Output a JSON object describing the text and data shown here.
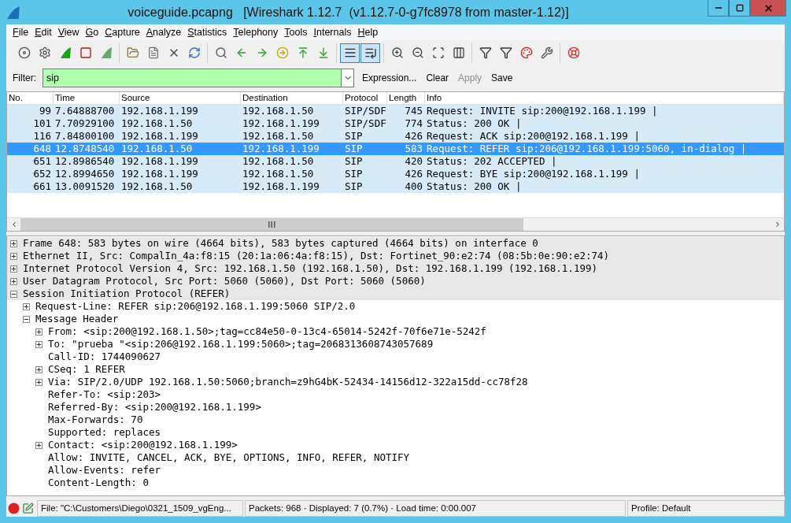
{
  "window": {
    "title": "voiceguide.pcapng   [Wireshark 1.12.7  (v1.12.7-0-g7fc8978 from master-1.12)]"
  },
  "menu": [
    "File",
    "Edit",
    "View",
    "Go",
    "Capture",
    "Analyze",
    "Statistics",
    "Telephony",
    "Tools",
    "Internals",
    "Help"
  ],
  "toolbar": {
    "groups": [
      [
        {
          "pressed": false
        },
        {
          "pressed": false
        },
        {
          "pressed": false
        },
        {
          "pressed": false
        },
        {
          "pressed": false
        }
      ],
      [
        {
          "pressed": false
        },
        {
          "pressed": false
        },
        {
          "pressed": false
        },
        {
          "pressed": false
        }
      ],
      [
        {
          "pressed": false
        },
        {
          "pressed": false
        },
        {
          "pressed": false
        },
        {
          "pressed": false
        },
        {
          "pressed": false
        },
        {
          "pressed": false
        }
      ],
      [
        {
          "pressed": true
        },
        {
          "pressed": true
        }
      ],
      [
        {
          "pressed": false
        },
        {
          "pressed": false
        },
        {
          "pressed": false
        },
        {
          "pressed": false
        }
      ],
      [
        {
          "pressed": false
        },
        {
          "pressed": false
        },
        {
          "pressed": false
        },
        {
          "pressed": false
        }
      ],
      [
        {
          "pressed": false
        }
      ]
    ]
  },
  "filter": {
    "label": "Filter:",
    "value": "sip",
    "buttons": [
      {
        "label": "Expression...",
        "disabled": false
      },
      {
        "label": "Clear",
        "disabled": false
      },
      {
        "label": "Apply",
        "disabled": true
      },
      {
        "label": "Save",
        "disabled": false
      }
    ]
  },
  "packet_list": {
    "columns": [
      "No.",
      "Time",
      "Source",
      "Destination",
      "Protocol",
      "Length",
      "Info"
    ],
    "rows": [
      {
        "cells": [
          "99",
          "7.64888700",
          "192.168.1.199",
          "192.168.1.50",
          "SIP/SDF",
          "745",
          "Request: INVITE sip:200@192.168.1.199 |"
        ],
        "selected": false
      },
      {
        "cells": [
          "101",
          "7.70929100",
          "192.168.1.50",
          "192.168.1.199",
          "SIP/SDF",
          "774",
          "Status: 200 OK |"
        ],
        "selected": false
      },
      {
        "cells": [
          "116",
          "7.84800100",
          "192.168.1.199",
          "192.168.1.50",
          "SIP",
          "426",
          "Request: ACK sip:200@192.168.1.199 |"
        ],
        "selected": false
      },
      {
        "cells": [
          "648",
          "12.8748540",
          "192.168.1.50",
          "192.168.1.199",
          "SIP",
          "583",
          "Request: REFER sip:206@192.168.1.199:5060, in-dialog |"
        ],
        "selected": true
      },
      {
        "cells": [
          "651",
          "12.8986540",
          "192.168.1.199",
          "192.168.1.50",
          "SIP",
          "420",
          "Status: 202 ACCEPTED |"
        ],
        "selected": false
      },
      {
        "cells": [
          "652",
          "12.8994650",
          "192.168.1.199",
          "192.168.1.50",
          "SIP",
          "426",
          "Request: BYE sip:200@192.168.1.199 |"
        ],
        "selected": false
      },
      {
        "cells": [
          "661",
          "13.0091520",
          "192.168.1.50",
          "192.168.1.199",
          "SIP",
          "400",
          "Status: 200 OK |"
        ],
        "selected": false
      }
    ]
  },
  "details": [
    {
      "kind": "branch",
      "expanded": false,
      "text": "Frame 648: 583 bytes on wire (4664 bits), 583 bytes captured (4664 bits) on interface 0"
    },
    {
      "kind": "branch",
      "expanded": false,
      "text": "Ethernet II, Src: CompalIn_4a:f8:15 (20:1a:06:4a:f8:15), Dst: Fortinet_90:e2:74 (08:5b:0e:90:e2:74)"
    },
    {
      "kind": "branch",
      "expanded": false,
      "text": "Internet Protocol Version 4, Src: 192.168.1.50 (192.168.1.50), Dst: 192.168.1.199 (192.168.1.199)"
    },
    {
      "kind": "branch",
      "expanded": false,
      "text": "User Datagram Protocol, Src Port: 5060 (5060), Dst Port: 5060 (5060)"
    },
    {
      "kind": "branch",
      "expanded": true,
      "text": "Session Initiation Protocol (REFER)",
      "children": [
        {
          "kind": "branch",
          "expanded": false,
          "text": "Request-Line: REFER sip:206@192.168.1.199:5060 SIP/2.0"
        },
        {
          "kind": "branch",
          "expanded": true,
          "text": "Message Header",
          "children": [
            {
              "kind": "branch",
              "expanded": false,
              "text": "From: <sip:200@192.168.1.50>;tag=cc84e50-0-13c4-65014-5242f-70f6e71e-5242f"
            },
            {
              "kind": "branch",
              "expanded": false,
              "text": "To: \"prueba \"<sip:206@192.168.1.199:5060>;tag=2068313608743057689"
            },
            {
              "kind": "leaf",
              "text": "Call-ID: 1744090627"
            },
            {
              "kind": "branch",
              "expanded": false,
              "text": "CSeq: 1 REFER"
            },
            {
              "kind": "branch",
              "expanded": false,
              "text": "Via: SIP/2.0/UDP 192.168.1.50:5060;branch=z9hG4bK-52434-14156d12-322a15dd-cc78f28"
            },
            {
              "kind": "leaf",
              "text": "Refer-To: <sip:203>"
            },
            {
              "kind": "leaf",
              "text": "Referred-By: <sip:200@192.168.1.199>"
            },
            {
              "kind": "leaf",
              "text": "Max-Forwards: 70"
            },
            {
              "kind": "leaf",
              "text": "Supported: replaces"
            },
            {
              "kind": "branch",
              "expanded": false,
              "text": "Contact: <sip:200@192.168.1.199>"
            },
            {
              "kind": "leaf",
              "text": "Allow: INVITE, CANCEL, ACK, BYE, OPTIONS, INFO, REFER, NOTIFY"
            },
            {
              "kind": "leaf",
              "text": "Allow-Events: refer"
            },
            {
              "kind": "leaf",
              "text": "Content-Length: 0"
            }
          ]
        }
      ]
    }
  ],
  "status_bar": {
    "file": "File: \"C:\\Customers\\Diego\\0321_1509_vgEng...",
    "packets": "Packets: 968 · Displayed: 7 (0.7%)  · Load time: 0:00.007",
    "profile": "Profile: Default"
  }
}
